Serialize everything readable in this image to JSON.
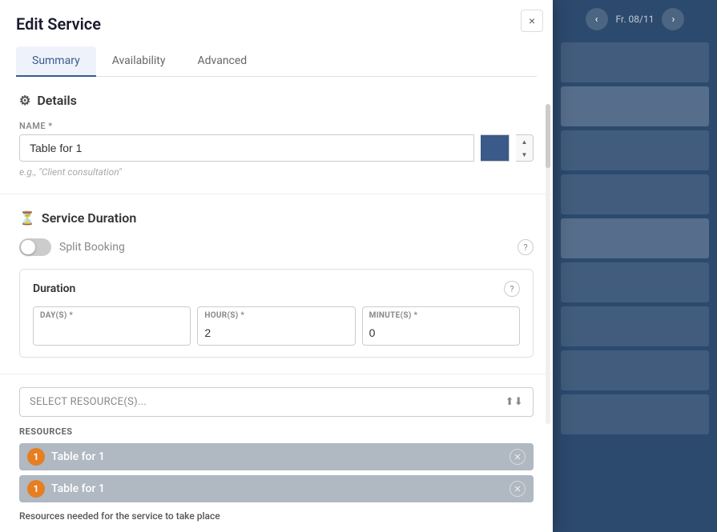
{
  "modal": {
    "title": "Edit Service",
    "close_label": "×",
    "tabs": [
      {
        "id": "summary",
        "label": "Summary",
        "active": true
      },
      {
        "id": "availability",
        "label": "Availability",
        "active": false
      },
      {
        "id": "advanced",
        "label": "Advanced",
        "active": false
      }
    ]
  },
  "details_section": {
    "title": "Details",
    "icon": "⚙",
    "name_field": {
      "label": "NAME *",
      "value": "Table for 1",
      "placeholder": "e.g., \"Client consultation\""
    }
  },
  "service_duration_section": {
    "title": "Service Duration",
    "icon": "⏳",
    "split_booking_label": "Split Booking",
    "duration_title": "Duration",
    "days_field": {
      "label": "DAY(S) *",
      "value": ""
    },
    "hours_field": {
      "label": "HOUR(S) *",
      "value": "2"
    },
    "minutes_field": {
      "label": "MINUTE(S) *",
      "value": "0"
    }
  },
  "resources_section": {
    "select_placeholder": "SELECT RESOURCE(S)...",
    "resources_label": "RESOURCES",
    "resources": [
      {
        "id": 1,
        "badge": "1",
        "name": "Table for 1"
      },
      {
        "id": 2,
        "badge": "1",
        "name": "Table for 1"
      }
    ],
    "note": "Resources needed for the service to take place"
  },
  "background": {
    "date_label": "Fr. 08/11",
    "nav_prev": "‹",
    "nav_next": "›"
  }
}
